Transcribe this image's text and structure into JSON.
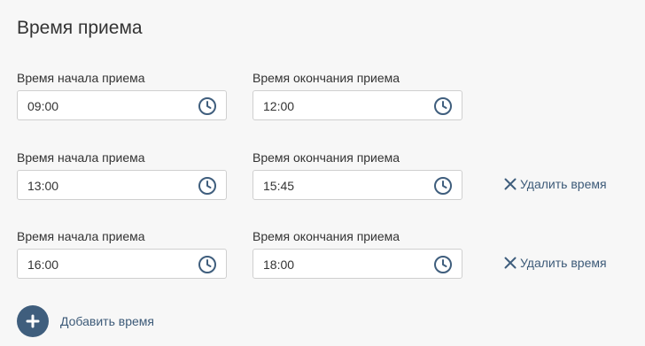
{
  "section": {
    "title": "Время приема"
  },
  "rows": [
    {
      "start_label": "Время начала приема",
      "start_value": "09:00",
      "end_label": "Время окончания приема",
      "end_value": "12:00"
    },
    {
      "start_label": "Время начала приема",
      "start_value": "13:00",
      "end_label": "Время окончания приема",
      "end_value": "15:45",
      "remove_label": "Удалить время"
    },
    {
      "start_label": "Время начала приема",
      "start_value": "16:00",
      "end_label": "Время окончания приема",
      "end_value": "18:00",
      "remove_label": "Удалить время"
    }
  ],
  "add": {
    "label": "Добавить время",
    "icon": "plus-icon"
  },
  "icons": {
    "clock": "clock-icon",
    "remove": "close-icon"
  },
  "colors": {
    "accent": "#3f5e7d",
    "link": "#3c5a78",
    "panel_bg": "#f7f7f7",
    "input_border": "#cfcfcf"
  }
}
